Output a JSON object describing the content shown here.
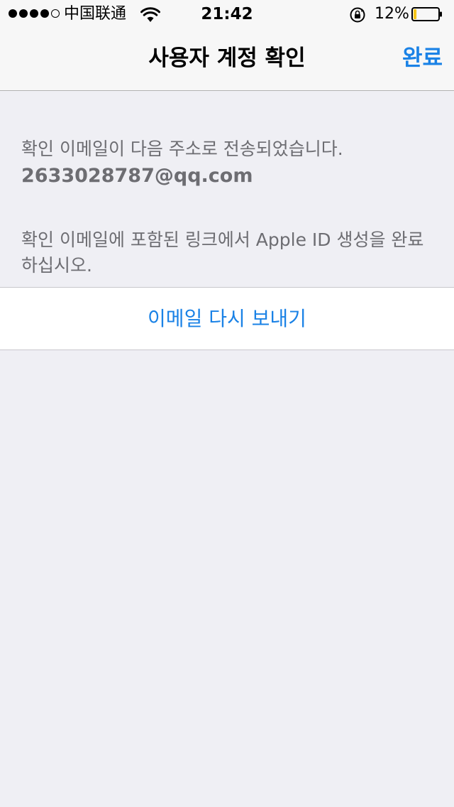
{
  "status_bar": {
    "carrier": "中国联通",
    "time": "21:42",
    "battery_percent": "12%",
    "battery_level": 0.12,
    "signal_bars_filled": 4,
    "signal_bars_total": 5
  },
  "nav": {
    "title": "사용자 계정 확인",
    "done_label": "완료"
  },
  "content": {
    "sent_message": "확인 이메일이 다음 주소로 전송되었습니다.",
    "email": "2633028787@qq.com",
    "instruction": "확인 이메일에 포함된 링크에서 Apple ID 생성을 완료하십시오.",
    "resend_label": "이메일 다시 보내기"
  },
  "colors": {
    "accent": "#1a82e6",
    "background": "#efeff4",
    "secondary_text": "#6d6d72",
    "battery_low": "#f5c518"
  }
}
